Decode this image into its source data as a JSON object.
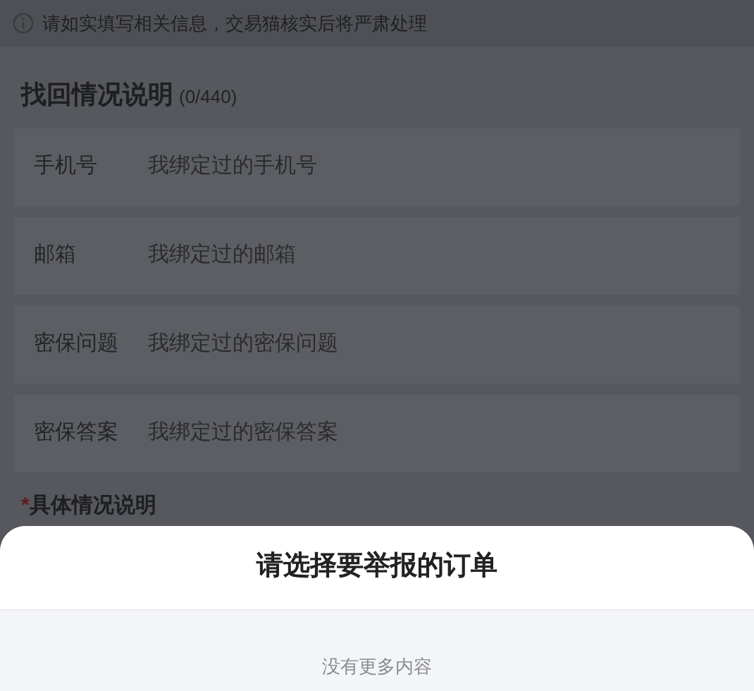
{
  "notice": {
    "text": "请如实填写相关信息，交易猫核实后将严肃处理"
  },
  "section": {
    "title": "找回情况说明",
    "count": "(0/440)"
  },
  "fields": [
    {
      "label": "手机号",
      "placeholder": "我绑定过的手机号"
    },
    {
      "label": "邮箱",
      "placeholder": "我绑定过的邮箱"
    },
    {
      "label": "密保问题",
      "placeholder": "我绑定过的密保问题"
    },
    {
      "label": "密保答案",
      "placeholder": "我绑定过的密保答案"
    }
  ],
  "detail": {
    "required_mark": "*",
    "label": "具体情况说明"
  },
  "sheet": {
    "title": "请选择要举报的订单",
    "empty_text": "没有更多内容"
  }
}
